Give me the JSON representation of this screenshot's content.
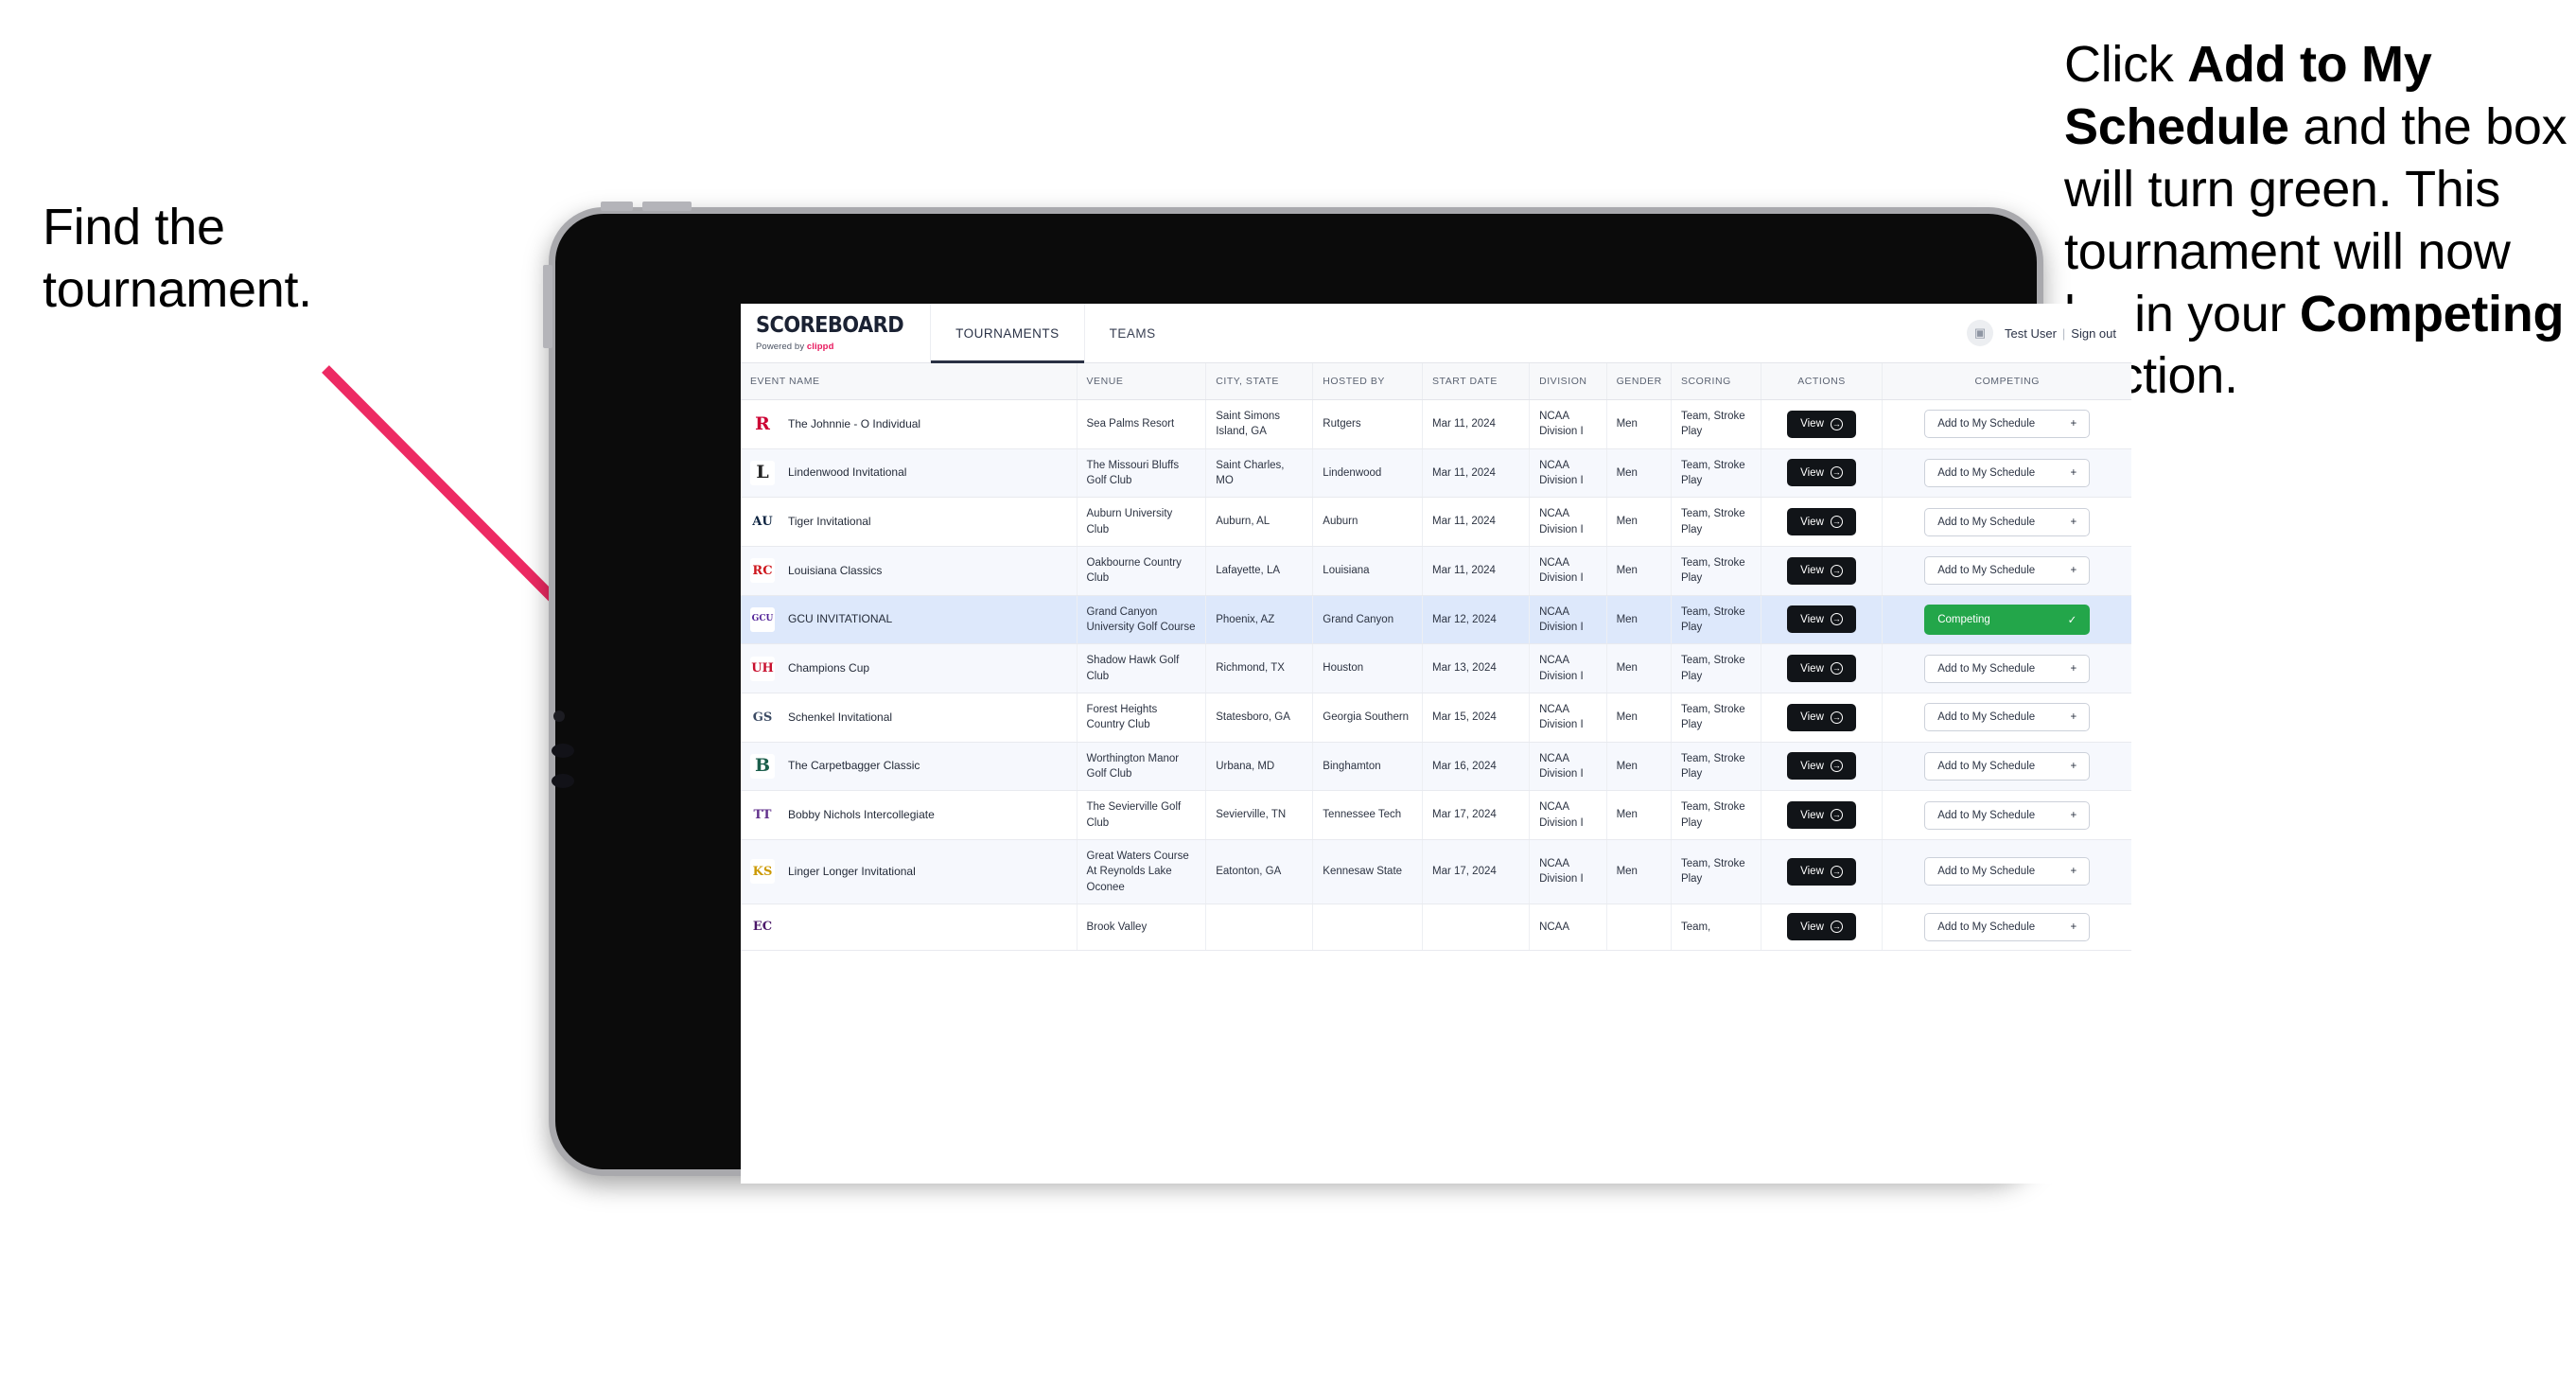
{
  "annotations": {
    "left": "Find the tournament.",
    "right_parts": [
      {
        "t": "Click ",
        "b": false
      },
      {
        "t": "Add to My Schedule",
        "b": true
      },
      {
        "t": " and the box will turn green. This tournament will now be in your ",
        "b": false
      },
      {
        "t": "Competing",
        "b": true
      },
      {
        "t": " section.",
        "b": false
      }
    ],
    "arrow_color": "#ed2a63"
  },
  "app": {
    "brand": {
      "title": "SCOREBOARD",
      "powered_prefix": "Powered by ",
      "powered_name": "clippd"
    },
    "tabs": [
      {
        "label": "TOURNAMENTS",
        "active": true
      },
      {
        "label": "TEAMS",
        "active": false
      }
    ],
    "user": {
      "avatar_icon": "user-image-icon",
      "name": "Test User",
      "separator": "|",
      "sign_out": "Sign out"
    },
    "table": {
      "columns": [
        "EVENT NAME",
        "VENUE",
        "CITY, STATE",
        "HOSTED BY",
        "START DATE",
        "DIVISION",
        "GENDER",
        "SCORING",
        "ACTIONS",
        "COMPETING"
      ],
      "view_label": "View",
      "add_label": "Add to My Schedule",
      "add_icon": "plus-icon",
      "competing_label": "Competing",
      "competing_icon": "check-icon",
      "competing_color": "#23a64a",
      "rows": [
        {
          "logo": "rutgers-logo",
          "logo_text": "R",
          "logo_color": "#cc0033",
          "logo_bg": "#ffffff",
          "event": "The Johnnie - O Individual",
          "venue": "Sea Palms Resort",
          "city": "Saint Simons Island, GA",
          "hosted_by": "Rutgers",
          "start_date": "Mar 11, 2024",
          "division": "NCAA Division I",
          "gender": "Men",
          "scoring": "Team, Stroke Play",
          "competing": false
        },
        {
          "logo": "lindenwood-logo",
          "logo_text": "L",
          "logo_color": "#232323",
          "logo_bg": "#ffffff",
          "event": "Lindenwood Invitational",
          "venue": "The Missouri Bluffs Golf Club",
          "city": "Saint Charles, MO",
          "hosted_by": "Lindenwood",
          "start_date": "Mar 11, 2024",
          "division": "NCAA Division I",
          "gender": "Men",
          "scoring": "Team, Stroke Play",
          "competing": false
        },
        {
          "logo": "auburn-logo",
          "logo_text": "AU",
          "logo_color": "#0c2340",
          "logo_bg": "#ffffff",
          "event": "Tiger Invitational",
          "venue": "Auburn University Club",
          "city": "Auburn, AL",
          "hosted_by": "Auburn",
          "start_date": "Mar 11, 2024",
          "division": "NCAA Division I",
          "gender": "Men",
          "scoring": "Team, Stroke Play",
          "competing": false
        },
        {
          "logo": "louisiana-ragin-cajuns-logo",
          "logo_text": "RC",
          "logo_color": "#ce181e",
          "logo_bg": "#ffffff",
          "event": "Louisiana Classics",
          "venue": "Oakbourne Country Club",
          "city": "Lafayette, LA",
          "hosted_by": "Louisiana",
          "start_date": "Mar 11, 2024",
          "division": "NCAA Division I",
          "gender": "Men",
          "scoring": "Team, Stroke Play",
          "competing": false
        },
        {
          "logo": "grand-canyon-lopes-logo",
          "logo_text": "GCU",
          "logo_color": "#522398",
          "logo_bg": "#ffffff",
          "event": "GCU INVITATIONAL",
          "venue": "Grand Canyon University Golf Course",
          "city": "Phoenix, AZ",
          "hosted_by": "Grand Canyon",
          "start_date": "Mar 12, 2024",
          "division": "NCAA Division I",
          "gender": "Men",
          "scoring": "Team, Stroke Play",
          "competing": true,
          "highlight": true
        },
        {
          "logo": "houston-cougars-logo",
          "logo_text": "UH",
          "logo_color": "#c8102e",
          "logo_bg": "#ffffff",
          "event": "Champions Cup",
          "venue": "Shadow Hawk Golf Club",
          "city": "Richmond, TX",
          "hosted_by": "Houston",
          "start_date": "Mar 13, 2024",
          "division": "NCAA Division I",
          "gender": "Men",
          "scoring": "Team, Stroke Play",
          "competing": false
        },
        {
          "logo": "georgia-southern-eagles-logo",
          "logo_text": "GS",
          "logo_color": "#3b4a63",
          "logo_bg": "#ffffff",
          "event": "Schenkel Invitational",
          "venue": "Forest Heights Country Club",
          "city": "Statesboro, GA",
          "hosted_by": "Georgia Southern",
          "start_date": "Mar 15, 2024",
          "division": "NCAA Division I",
          "gender": "Men",
          "scoring": "Team, Stroke Play",
          "competing": false
        },
        {
          "logo": "binghamton-bearcats-logo",
          "logo_text": "B",
          "logo_color": "#1b5e4b",
          "logo_bg": "#ffffff",
          "event": "The Carpetbagger Classic",
          "venue": "Worthington Manor Golf Club",
          "city": "Urbana, MD",
          "hosted_by": "Binghamton",
          "start_date": "Mar 16, 2024",
          "division": "NCAA Division I",
          "gender": "Men",
          "scoring": "Team, Stroke Play",
          "competing": false
        },
        {
          "logo": "tennessee-tech-golden-eagles-logo",
          "logo_text": "TT",
          "logo_color": "#62318c",
          "logo_bg": "#ffffff",
          "event": "Bobby Nichols Intercollegiate",
          "venue": "The Sevierville Golf Club",
          "city": "Sevierville, TN",
          "hosted_by": "Tennessee Tech",
          "start_date": "Mar 17, 2024",
          "division": "NCAA Division I",
          "gender": "Men",
          "scoring": "Team, Stroke Play",
          "competing": false
        },
        {
          "logo": "kennesaw-state-owls-logo",
          "logo_text": "KS",
          "logo_color": "#cc9900",
          "logo_bg": "#ffffff",
          "event": "Linger Longer Invitational",
          "venue": "Great Waters Course At Reynolds Lake Oconee",
          "city": "Eatonton, GA",
          "hosted_by": "Kennesaw State",
          "start_date": "Mar 17, 2024",
          "division": "NCAA Division I",
          "gender": "Men",
          "scoring": "Team, Stroke Play",
          "competing": false
        },
        {
          "logo": "east-carolina-pirates-logo",
          "logo_text": "EC",
          "logo_color": "#4b1869",
          "logo_bg": "#ffffff",
          "event": "",
          "venue": "Brook Valley",
          "city": "",
          "hosted_by": "",
          "start_date": "",
          "division": "NCAA",
          "gender": "",
          "scoring": "Team,",
          "competing": false,
          "cut": true
        }
      ]
    }
  }
}
